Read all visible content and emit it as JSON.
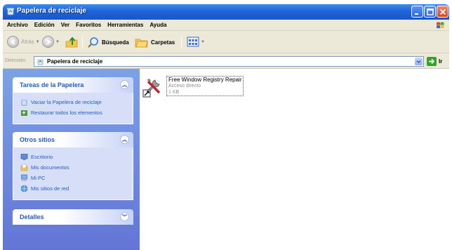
{
  "window": {
    "title": "Papelera de reciclaje",
    "accent_color": "#1f64d9"
  },
  "menu": {
    "items": [
      "Archivo",
      "Edición",
      "Ver",
      "Favoritos",
      "Herramientas",
      "Ayuda"
    ]
  },
  "toolbar": {
    "back_label": "Atrás",
    "search_label": "Búsqueda",
    "folders_label": "Carpetas"
  },
  "address": {
    "label": "Dirección",
    "value": "Papelera de reciclaje",
    "go_label": "Ir"
  },
  "left_pane": {
    "panels": [
      {
        "title": "Tareas de la Papelera",
        "items": [
          {
            "label": "Vaciar la Papelera de reciclaje",
            "icon": "empty-recycle-bin-icon"
          },
          {
            "label": "Restaurar todos los elementos",
            "icon": "restore-icon"
          }
        ]
      },
      {
        "title": "Otros sitios",
        "items": [
          {
            "label": "Escritorio",
            "icon": "desktop-icon"
          },
          {
            "label": "Mis documentos",
            "icon": "my-documents-icon"
          },
          {
            "label": "Mi PC",
            "icon": "my-computer-icon"
          },
          {
            "label": "Mis sitios de red",
            "icon": "network-places-icon"
          }
        ]
      },
      {
        "title": "Detalles",
        "items": []
      }
    ]
  },
  "files": [
    {
      "name": "Free Window Registry Repair",
      "type": "Acceso directo",
      "size": "1 KB",
      "icon": "repair-tools-shortcut-icon"
    }
  ]
}
